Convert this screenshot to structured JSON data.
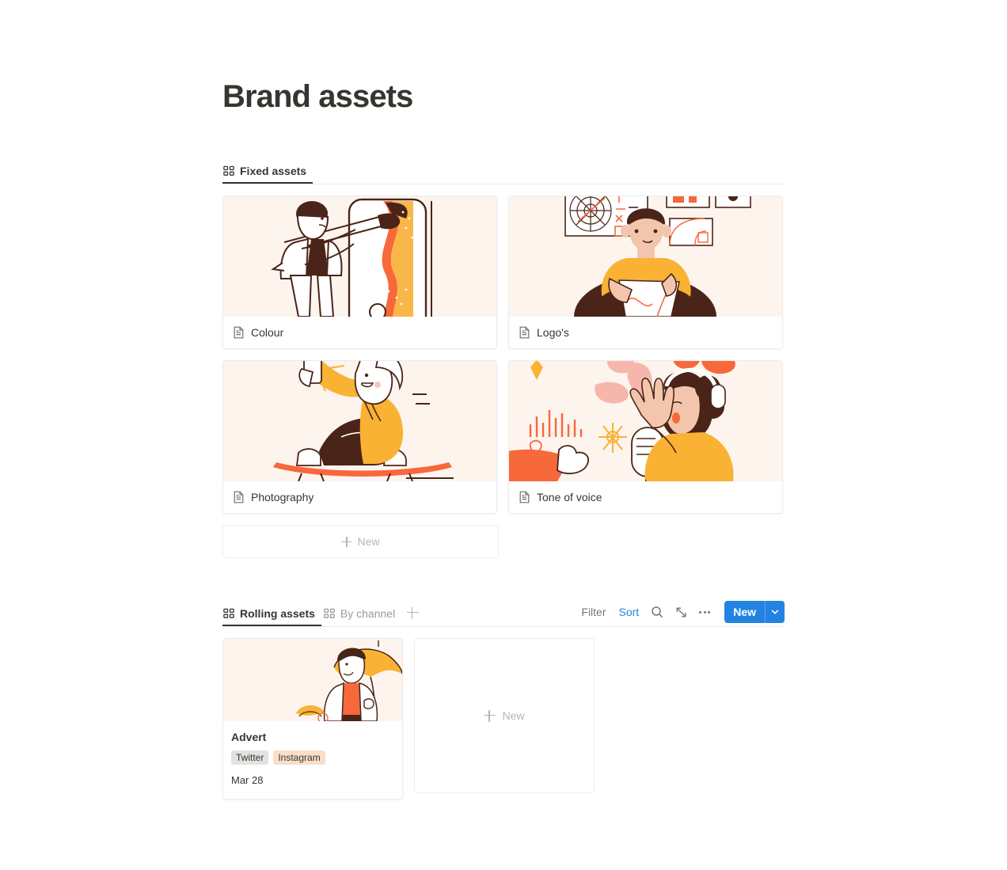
{
  "page": {
    "title": "Brand assets"
  },
  "fixed_section": {
    "tabs": [
      {
        "label": "Fixed assets",
        "icon": "grid-icon",
        "active": true
      }
    ],
    "cards": [
      {
        "title": "Colour",
        "icon": "document-icon",
        "illustration": "painter-phone"
      },
      {
        "title": "Logo's",
        "icon": "document-icon",
        "illustration": "designer-desk"
      },
      {
        "title": "Photography",
        "icon": "document-icon",
        "illustration": "skater-selfie"
      },
      {
        "title": "Tone of voice",
        "icon": "document-icon",
        "illustration": "singer-microphone"
      }
    ],
    "new_row_label": "New"
  },
  "rolling_section": {
    "tabs": [
      {
        "label": "Rolling assets",
        "icon": "grid-icon",
        "active": true
      },
      {
        "label": "By channel",
        "icon": "grid-icon",
        "active": false
      }
    ],
    "add_view_icon": "plus-icon",
    "toolbar": {
      "filter_label": "Filter",
      "sort_label": "Sort",
      "search_icon": "search-icon",
      "expand_icon": "expand-icon",
      "more_icon": "more-horizontal-icon",
      "new_label": "New",
      "new_caret_icon": "chevron-down-icon",
      "accent_color": "#2383e2"
    },
    "cards": [
      {
        "title": "Advert",
        "illustration": "umbrella-person",
        "tags": [
          {
            "label": "Twitter",
            "color": "#e3e2e0"
          },
          {
            "label": "Instagram",
            "color": "#fadec9"
          }
        ],
        "date": "Mar 28"
      }
    ],
    "new_card_label": "New"
  }
}
